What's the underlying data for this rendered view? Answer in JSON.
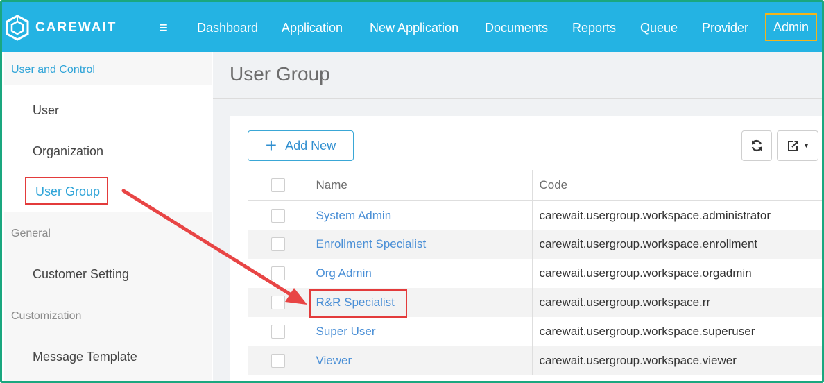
{
  "brand": {
    "name": "CAREWAIT"
  },
  "nav": {
    "menu_icon": "≡",
    "items": [
      {
        "label": "Dashboard"
      },
      {
        "label": "Application"
      },
      {
        "label": "New Application"
      },
      {
        "label": "Documents"
      },
      {
        "label": "Reports"
      },
      {
        "label": "Queue"
      },
      {
        "label": "Provider"
      },
      {
        "label": "Admin"
      }
    ]
  },
  "sidebar": {
    "sections": [
      {
        "heading": "User and Control",
        "items": [
          "User",
          "Organization",
          "User Group"
        ]
      },
      {
        "heading": "General",
        "items": [
          "Customer Setting"
        ]
      },
      {
        "heading": "Customization",
        "items": [
          "Message Template"
        ]
      }
    ]
  },
  "page": {
    "title": "User Group",
    "add_button": "Add New",
    "table": {
      "headers": [
        "Name",
        "Code"
      ],
      "rows": [
        {
          "name": "System Admin",
          "code": "carewait.usergroup.workspace.administrator"
        },
        {
          "name": "Enrollment Specialist",
          "code": "carewait.usergroup.workspace.enrollment"
        },
        {
          "name": "Org Admin",
          "code": "carewait.usergroup.workspace.orgadmin"
        },
        {
          "name": "R&R Specialist",
          "code": "carewait.usergroup.workspace.rr"
        },
        {
          "name": "Super User",
          "code": "carewait.usergroup.workspace.superuser"
        },
        {
          "name": "Viewer",
          "code": "carewait.usergroup.workspace.viewer"
        }
      ]
    }
  },
  "colors": {
    "navbar": "#24b3e3",
    "accent": "#2fa4d8",
    "highlight_red": "#e33b3b",
    "highlight_gold": "#f4b41a"
  }
}
